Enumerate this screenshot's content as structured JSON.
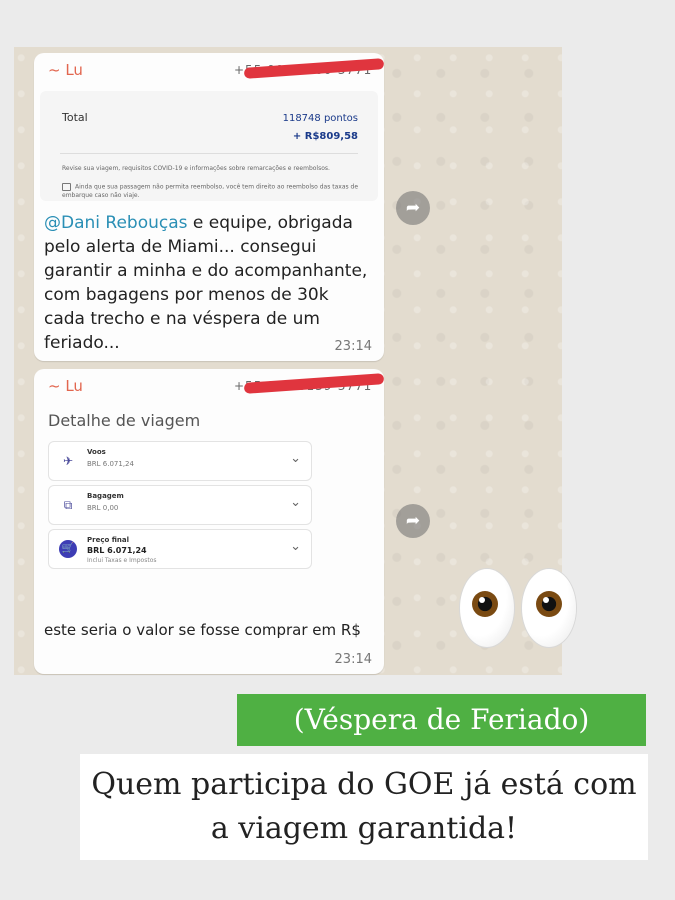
{
  "chat": {
    "message1": {
      "sender": "~ Lu",
      "phone_partial": "+55 00 00000-3771",
      "quote": {
        "total_label": "Total",
        "points": "118748 pontos",
        "cash": "+ R$809,58",
        "note1": "Revise sua viagem, requisitos COVID-19 e informações sobre remarcações e reembolsos.",
        "note2": "Ainda que sua passagem não permita reembolso, você tem direito ao reembolso das taxas de embarque caso não viaje."
      },
      "mention": "@Dani Rebouças",
      "text": " e equipe, obrigada pelo alerta de Miami... consegui garantir a minha e do acompanhante, com bagagens por menos de 30k cada trecho e na véspera de um feriado...",
      "time": "23:14"
    },
    "message2": {
      "sender": "~ Lu",
      "phone_partial": "+55 00 00139-3771",
      "detail_title": "Detalhe de viagem",
      "cards": [
        {
          "icon": "plane-icon",
          "title": "Voos",
          "value": "BRL 6.071,24"
        },
        {
          "icon": "luggage-icon",
          "title": "Bagagem",
          "value": "BRL 0,00"
        },
        {
          "icon": "cart-icon",
          "title": "Preço final",
          "value": "BRL 6.071,24",
          "sub": "Inclui Taxas e Impostos"
        }
      ],
      "text": "este seria o valor se fosse comprar em R$",
      "time": "23:14"
    },
    "forward_icon": "share-arrow-icon"
  },
  "decoration": {
    "emoji": "eyes-emoji"
  },
  "captions": {
    "line1": "(Véspera de Feriado)",
    "line2": "Quem participa do GOE já está com a viagem garantida!"
  },
  "colors": {
    "chat_bg": "#e3dccf",
    "sender": "#e2664f",
    "mention": "#2a8fb5",
    "redaction": "#e0353e",
    "caption_green": "#4fb043"
  }
}
